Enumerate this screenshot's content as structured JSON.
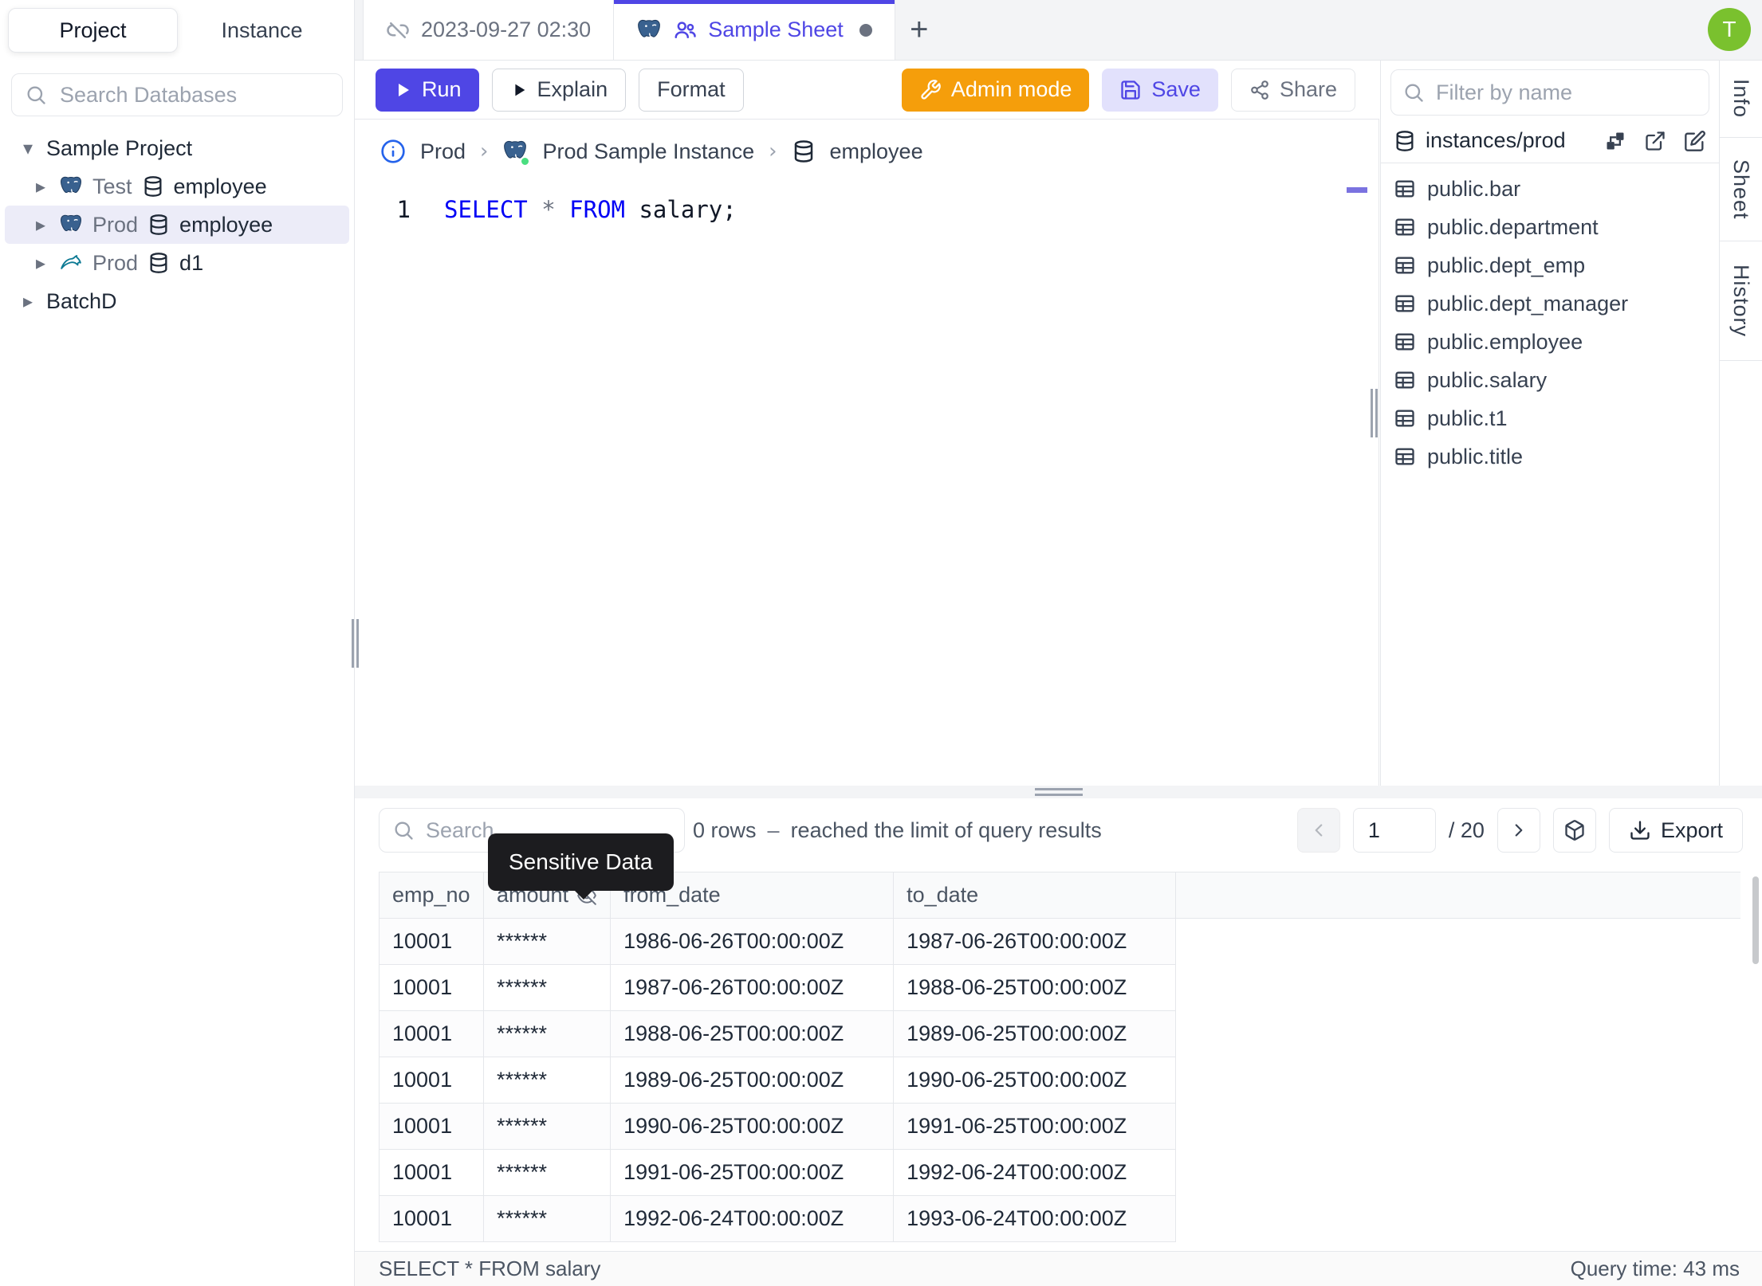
{
  "colors": {
    "accent": "#4f46e5",
    "admin_orange": "#f59e0b",
    "avatar_green": "#7ac12e",
    "keyword_blue": "#0000f5",
    "tooltip_bg": "#1c1c1f",
    "selected_row_bg": "#ececf8",
    "breadcrumb_info_blue": "#2563eb"
  },
  "sidebar": {
    "tabs": [
      {
        "label": "Project"
      },
      {
        "label": "Instance"
      }
    ],
    "search_placeholder": "Search Databases",
    "tree": {
      "project": "Sample Project",
      "items": [
        {
          "env": "Test",
          "db": "employee",
          "engine": "postgres"
        },
        {
          "env": "Prod",
          "db": "employee",
          "engine": "postgres"
        },
        {
          "env": "Prod",
          "db": "d1",
          "engine": "mysql"
        }
      ],
      "collapsed_project": "BatchD"
    }
  },
  "tabbar": {
    "tab1": "2023-09-27 02:30",
    "tab2": "Sample Sheet",
    "new_tab": "+"
  },
  "avatar": {
    "initial": "T"
  },
  "toolbar": {
    "run": "Run",
    "explain": "Explain",
    "format": "Format",
    "admin_mode": "Admin mode",
    "save": "Save",
    "share": "Share"
  },
  "breadcrumb": {
    "environment": "Prod",
    "separator": "›",
    "instance": "Prod Sample Instance",
    "database": "employee"
  },
  "editor": {
    "line_number": "1",
    "tokens": [
      {
        "text": "SELECT",
        "type": "keyword"
      },
      {
        "text": " ",
        "type": "plain"
      },
      {
        "text": "*",
        "type": "operator"
      },
      {
        "text": " ",
        "type": "plain"
      },
      {
        "text": "FROM",
        "type": "keyword"
      },
      {
        "text": " salary;",
        "type": "plain"
      }
    ]
  },
  "schema_panel": {
    "filter_placeholder": "Filter by name",
    "header": "instances/prod",
    "tables": [
      "public.bar",
      "public.department",
      "public.dept_emp",
      "public.dept_manager",
      "public.employee",
      "public.salary",
      "public.t1",
      "public.title"
    ]
  },
  "side_tabs": [
    {
      "label": "Info"
    },
    {
      "label": "Sheet"
    },
    {
      "label": "History"
    }
  ],
  "results": {
    "search_placeholder": "Search",
    "tooltip": "Sensitive Data",
    "rows_count": "0 rows",
    "dash": "–",
    "limit_note": "reached the limit of query results",
    "pagination": {
      "page": "1",
      "total": "/ 20",
      "export": "Export"
    },
    "table": {
      "headers": [
        "emp_no",
        "amount",
        "from_date",
        "to_date"
      ],
      "rows": [
        {
          "emp_no": "10001",
          "amount": "******",
          "from_date": "1986-06-26T00:00:00Z",
          "to_date": "1987-06-26T00:00:00Z"
        },
        {
          "emp_no": "10001",
          "amount": "******",
          "from_date": "1987-06-26T00:00:00Z",
          "to_date": "1988-06-25T00:00:00Z"
        },
        {
          "emp_no": "10001",
          "amount": "******",
          "from_date": "1988-06-25T00:00:00Z",
          "to_date": "1989-06-25T00:00:00Z"
        },
        {
          "emp_no": "10001",
          "amount": "******",
          "from_date": "1989-06-25T00:00:00Z",
          "to_date": "1990-06-25T00:00:00Z"
        },
        {
          "emp_no": "10001",
          "amount": "******",
          "from_date": "1990-06-25T00:00:00Z",
          "to_date": "1991-06-25T00:00:00Z"
        },
        {
          "emp_no": "10001",
          "amount": "******",
          "from_date": "1991-06-25T00:00:00Z",
          "to_date": "1992-06-24T00:00:00Z"
        },
        {
          "emp_no": "10001",
          "amount": "******",
          "from_date": "1992-06-24T00:00:00Z",
          "to_date": "1993-06-24T00:00:00Z"
        }
      ]
    },
    "status": {
      "left": "SELECT * FROM salary",
      "right": "Query time: 43 ms"
    }
  }
}
